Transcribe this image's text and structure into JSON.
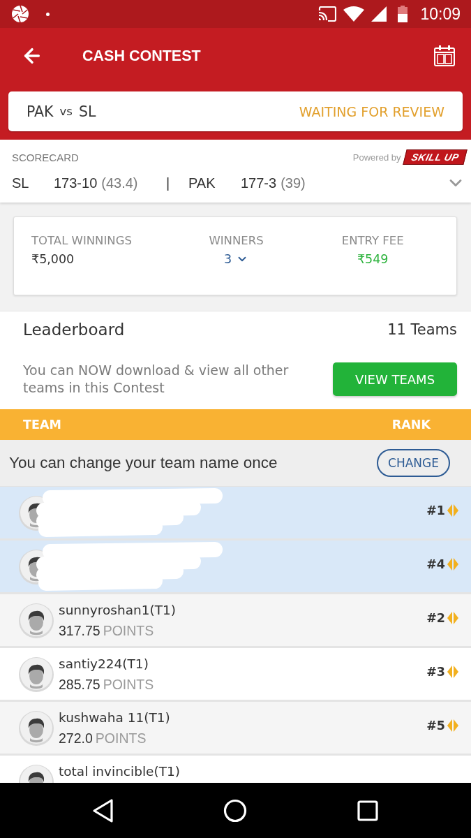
{
  "status_bar": {
    "time": "10:09"
  },
  "header": {
    "title": "CASH CONTEST"
  },
  "match": {
    "team_a": "PAK",
    "versus": "vs",
    "team_b": "SL",
    "status": "WAITING FOR REVIEW"
  },
  "scorecard": {
    "label": "SCORECARD",
    "powered_by": "Powered by",
    "brand": "SKILL UP",
    "separator": "|",
    "innings": [
      {
        "team": "SL",
        "score": "173-10",
        "overs": "(43.4)"
      },
      {
        "team": "PAK",
        "score": "177-3",
        "overs": "(39)"
      }
    ]
  },
  "prize": {
    "items": [
      {
        "kind": "amount",
        "label": "TOTAL WINNINGS",
        "value": "₹5,000"
      },
      {
        "kind": "dropdown",
        "label": "WINNERS",
        "value": "3"
      },
      {
        "kind": "fee",
        "label": "ENTRY FEE",
        "value": "₹549"
      }
    ]
  },
  "leaderboard": {
    "title": "Leaderboard",
    "count": "11 Teams",
    "message": "You can NOW download & view all other teams in this Contest",
    "button": "VIEW TEAMS"
  },
  "table": {
    "columns": [
      "TEAM",
      "RANK"
    ],
    "notice": "You can change your team name once",
    "notice_button": "CHANGE",
    "rows": [
      {
        "kind": "redacted",
        "highlighted": true,
        "rank": "#1"
      },
      {
        "kind": "redacted",
        "highlighted": true,
        "rank": "#4"
      },
      {
        "kind": "team",
        "highlighted": false,
        "name": "sunnyroshan1(T1)",
        "points": "317.75",
        "points_unit": "POINTS",
        "rank": "#2"
      },
      {
        "kind": "team",
        "highlighted": false,
        "name": "santiy224(T1)",
        "points": "285.75",
        "points_unit": "POINTS",
        "rank": "#3"
      },
      {
        "kind": "team",
        "highlighted": false,
        "name": "kushwaha 11(T1)",
        "points": "272.0",
        "points_unit": "POINTS",
        "rank": "#5"
      },
      {
        "kind": "team",
        "highlighted": false,
        "name": "total invincible(T1)"
      }
    ]
  }
}
